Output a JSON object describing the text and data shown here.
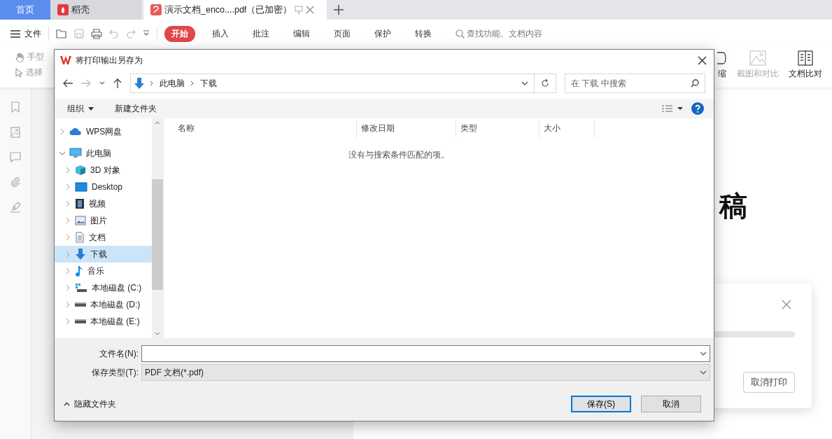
{
  "app_tabs": [
    {
      "label": "首页",
      "kind": "home",
      "selected": false
    },
    {
      "label": "稻壳",
      "kind": "docer",
      "selected": false
    },
    {
      "label": "演示文档_enco....pdf（已加密）",
      "kind": "pdf",
      "selected": true
    }
  ],
  "toolbar": {
    "file_menu": "文件",
    "search_placeholder": "查找功能、文档内容",
    "tabs": [
      {
        "label": "开始",
        "selected": true
      },
      {
        "label": "插入",
        "selected": false
      },
      {
        "label": "批注",
        "selected": false
      },
      {
        "label": "编辑",
        "selected": false
      },
      {
        "label": "页面",
        "selected": false
      },
      {
        "label": "保护",
        "selected": false
      },
      {
        "label": "转换",
        "selected": false
      }
    ]
  },
  "ribbon": {
    "left_tools": [
      {
        "label": "手型",
        "kind": "hand"
      },
      {
        "label": "选择",
        "kind": "cursor"
      }
    ],
    "right_tools": [
      {
        "label": "缩",
        "kind": "compress",
        "disabled": false
      },
      {
        "label": "截图和对比",
        "kind": "screenshot",
        "disabled": true
      },
      {
        "label": "文档比对",
        "kind": "compare",
        "disabled": false
      }
    ]
  },
  "document": {
    "heading_fragment": "稿"
  },
  "print_popup": {
    "cancel_button": "取消打印"
  },
  "dialog": {
    "title": "将打印输出另存为",
    "breadcrumb": [
      "此电脑",
      "下载"
    ],
    "search_placeholder": "在 下载 中搜索",
    "organize": "组织",
    "new_folder": "新建文件夹",
    "nav": [
      {
        "label": "WPS网盘",
        "kind": "cloud",
        "expanded": false,
        "selected": false
      },
      {
        "label": "此电脑",
        "kind": "pc",
        "expanded": true,
        "selected": false,
        "children": [
          {
            "label": "3D 对象",
            "kind": "cube",
            "expanded": false,
            "selected": false
          },
          {
            "label": "Desktop",
            "kind": "desktop",
            "expanded": false,
            "selected": false
          },
          {
            "label": "视频",
            "kind": "video",
            "expanded": false,
            "selected": false
          },
          {
            "label": "图片",
            "kind": "picture",
            "expanded": false,
            "selected": false
          },
          {
            "label": "文档",
            "kind": "doc",
            "expanded": false,
            "selected": false
          },
          {
            "label": "下载",
            "kind": "download",
            "expanded": false,
            "selected": true
          },
          {
            "label": "音乐",
            "kind": "music",
            "expanded": false,
            "selected": false
          },
          {
            "label": "本地磁盘 (C:)",
            "kind": "sysdrive",
            "expanded": false,
            "selected": false
          },
          {
            "label": "本地磁盘 (D:)",
            "kind": "drive",
            "expanded": false,
            "selected": false
          },
          {
            "label": "本地磁盘 (E:)",
            "kind": "drive",
            "expanded": false,
            "selected": false
          }
        ]
      }
    ],
    "columns": [
      "名称",
      "修改日期",
      "类型",
      "大小"
    ],
    "empty_message": "没有与搜索条件匹配的项。",
    "filename_label": "文件名(N):",
    "filetype_label": "保存类型(T):",
    "filetype_value": "PDF 文档(*.pdf)",
    "hide_folders": "隐藏文件夹",
    "buttons": [
      {
        "label": "保存(S)",
        "kind": "primary"
      },
      {
        "label": "取消",
        "kind": "secondary"
      }
    ]
  }
}
